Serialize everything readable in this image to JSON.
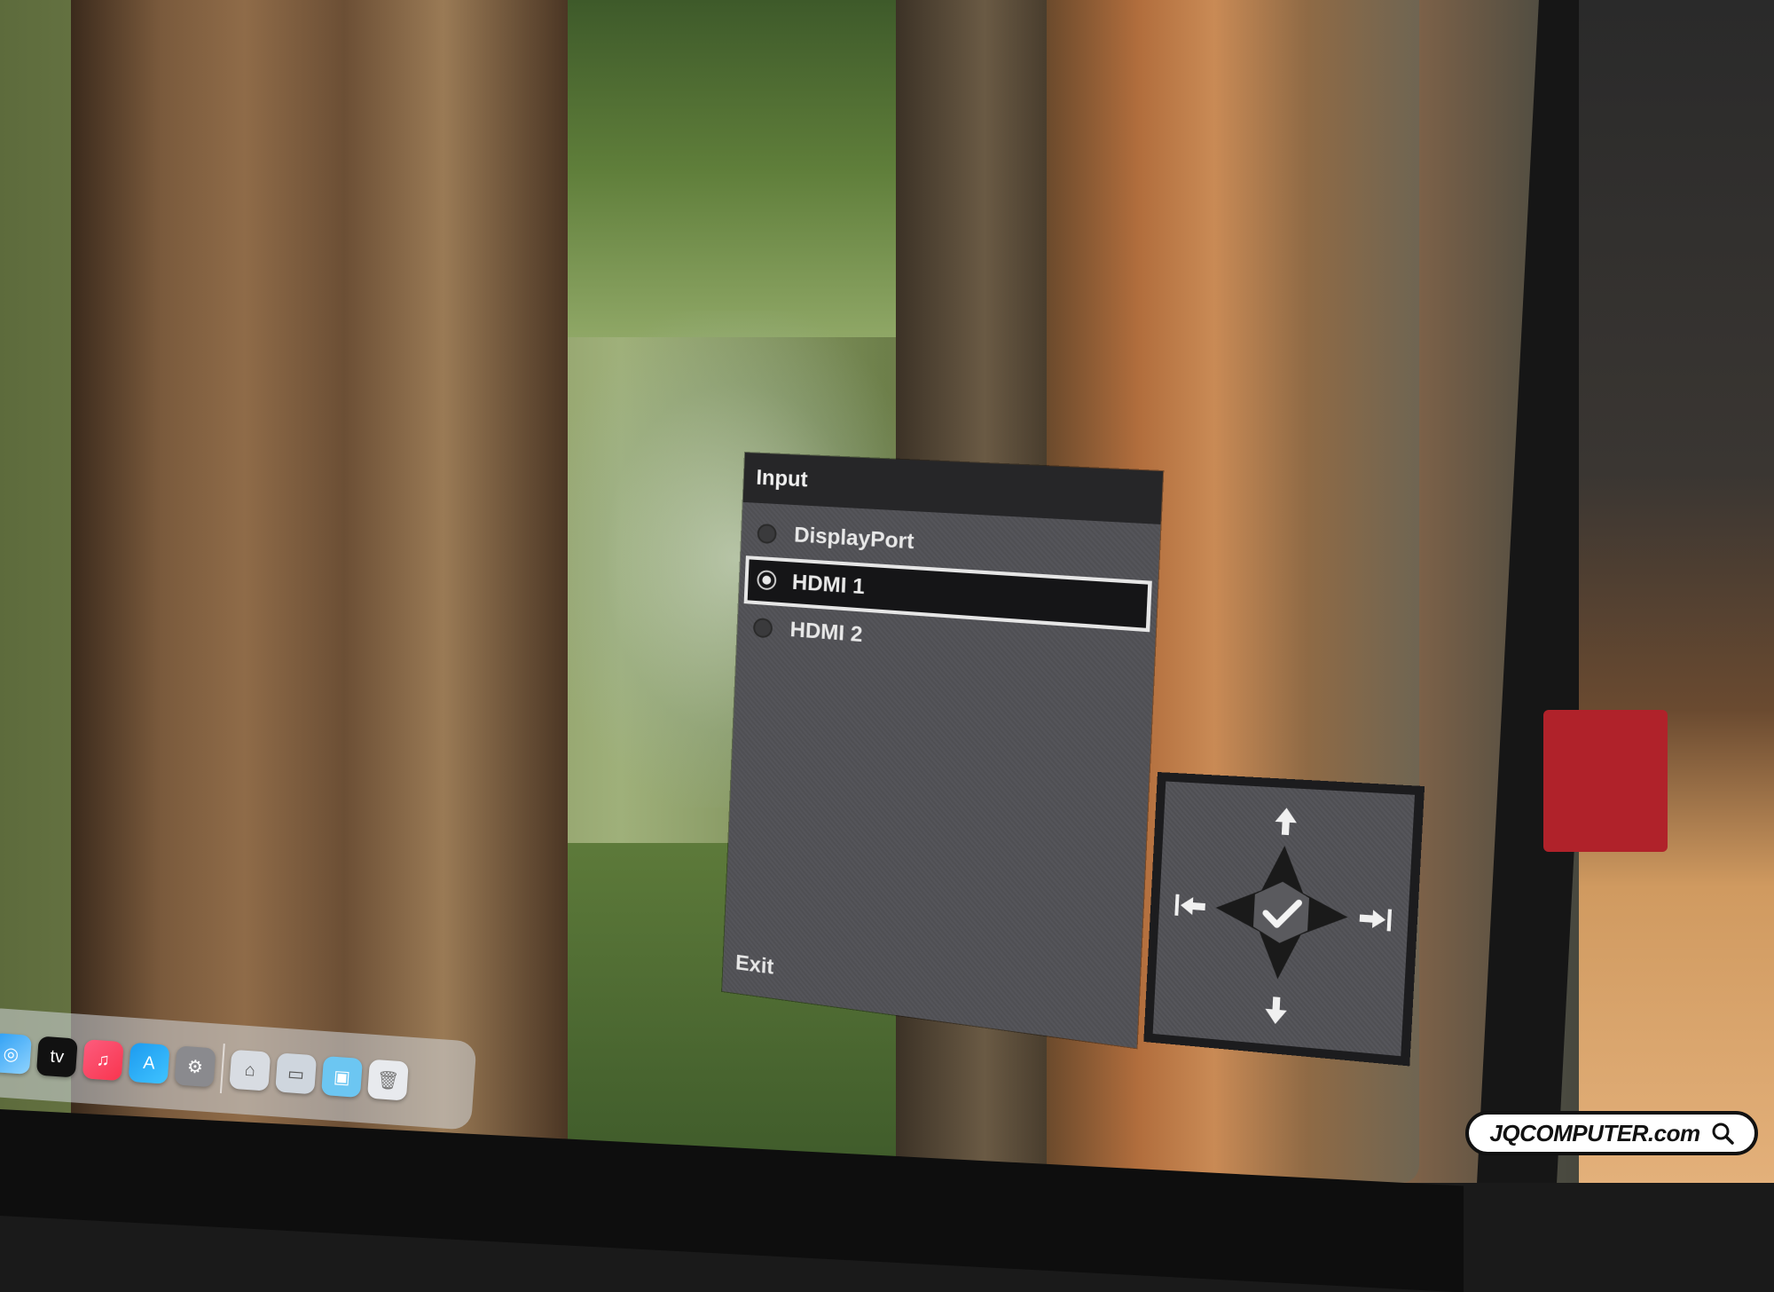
{
  "osd": {
    "title": "Input",
    "options": [
      {
        "label": "DisplayPort",
        "selected": false
      },
      {
        "label": "HDMI 1",
        "selected": true
      },
      {
        "label": "HDMI 2",
        "selected": false
      }
    ],
    "exit_label": "Exit"
  },
  "joystick": {
    "icons": [
      "up-arrow-icon",
      "down-arrow-icon",
      "left-arrow-icon",
      "right-arrow-icon",
      "checkmark-icon"
    ]
  },
  "dock": {
    "icons": [
      "safari-icon",
      "apple-tv-icon",
      "music-icon",
      "app-store-icon",
      "system-settings-icon",
      "finder-icon",
      "preview-icon",
      "folder-icon",
      "trash-icon"
    ]
  },
  "watermark": {
    "text": "JQCOMPUTER.com"
  },
  "colors": {
    "osd_background": "#505054",
    "osd_header": "#262628",
    "selection_background": "#151517",
    "selection_border": "#e6e6e6"
  }
}
